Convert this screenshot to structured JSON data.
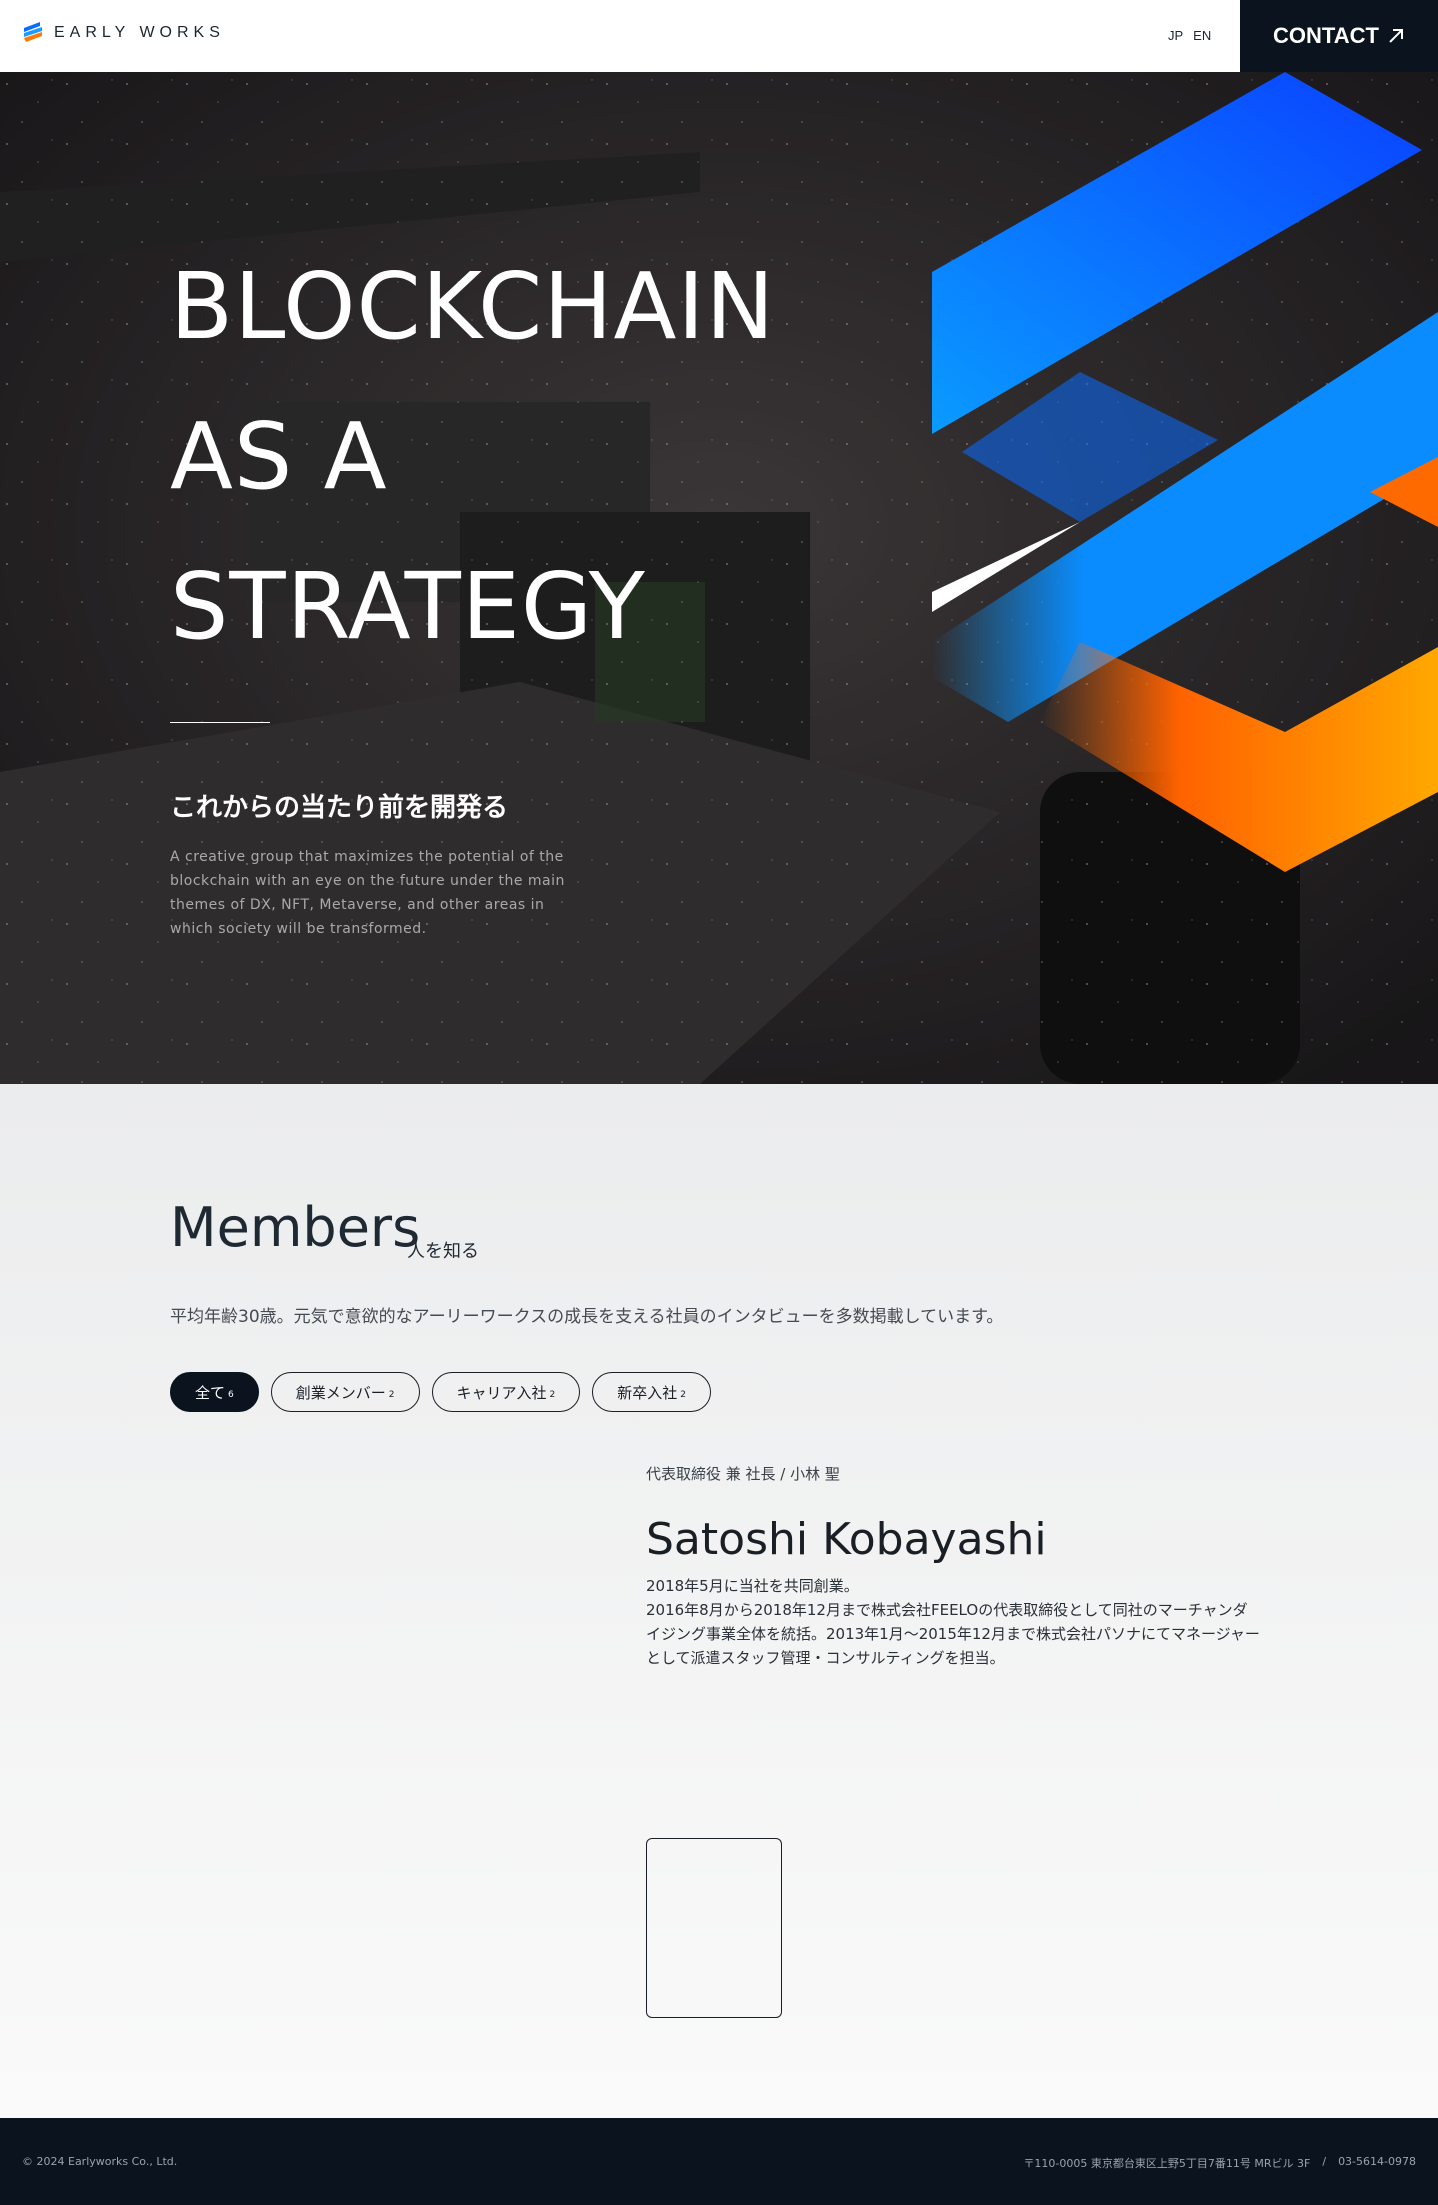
{
  "header": {
    "logo_text": "EARLY WORKS",
    "lang": [
      "JP",
      "EN"
    ],
    "contact_label": "CONTACT"
  },
  "hero": {
    "title_lines": [
      "BLOCKCHAIN",
      "AS A",
      "STRATEGY"
    ],
    "subtitle": "これからの当たり前を開発る",
    "description": "A creative group that maximizes the potential of the blockchain with an eye on the future under the main themes of DX, NFT, Metaverse, and other areas in which society will be transformed."
  },
  "members": {
    "title": "Members",
    "title_jp": "人を知る",
    "intro": "平均年齢30歳。元気で意欲的なアーリーワークスの成長を支える社員のインタビューを多数掲載しています。",
    "filters": [
      {
        "label": "全て",
        "count": "6"
      },
      {
        "label": "創業メンバー",
        "count": "2"
      },
      {
        "label": "キャリア入社",
        "count": "2"
      },
      {
        "label": "新卒入社",
        "count": "2"
      }
    ],
    "featured": {
      "role": "代表取締役 兼 社長 / 小林 聖",
      "name": "Satoshi Kobayashi",
      "bio_line1": "2018年5月に当社を共同創業。",
      "bio_line2": "2016年8月から2018年12月まで株式会社FEELOの代表取締役として同社のマーチャンダイジング事業全体を統括。2013年1月〜2015年12月まで株式会社パソナにてマネージャーとして派遣スタッフ管理・コンサルティングを担当。"
    }
  },
  "footer": {
    "copyright": "© 2024 Earlyworks Co., Ltd.",
    "address": "〒110-0005 東京都台東区上野5丁目7番11号 MRビル 3F",
    "separator": "/",
    "phone": "03-5614-0978"
  },
  "colors": {
    "dark": "#0b131e",
    "blue": "#0a7cff",
    "orange": "#ff6a00"
  }
}
